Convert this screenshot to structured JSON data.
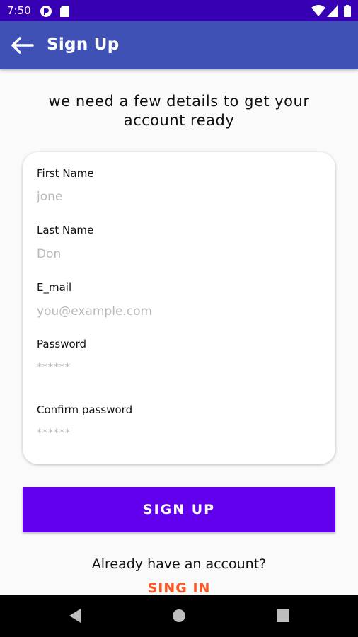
{
  "status_bar": {
    "time": "7:50",
    "left_icons": [
      "pocket-casts-icon",
      "sd-card-icon"
    ],
    "right_icons": [
      "wifi-icon",
      "signal-icon",
      "battery-icon"
    ]
  },
  "app_bar": {
    "title": "Sign Up",
    "back_icon": "arrow-left-icon",
    "color": "#3f51b5"
  },
  "intro_text": "we need a few details to get your account ready",
  "form": {
    "fields": [
      {
        "label": "First Name",
        "placeholder": "jone",
        "value": ""
      },
      {
        "label": "Last Name",
        "placeholder": "Don",
        "value": ""
      },
      {
        "label": "E_mail",
        "placeholder": "you@example.com",
        "value": ""
      },
      {
        "label": "Password",
        "placeholder": "******",
        "value": ""
      },
      {
        "label": "Confirm password",
        "placeholder": "******",
        "value": ""
      }
    ]
  },
  "signup_button": {
    "label": "SIGN UP",
    "color": "#6200ee"
  },
  "footer": {
    "prompt": "Already have an account?",
    "signin_label": "SING IN",
    "signin_color": "#ff5722"
  },
  "nav_bar": {
    "buttons": [
      "back-triangle-icon",
      "home-circle-icon",
      "recents-square-icon"
    ]
  }
}
